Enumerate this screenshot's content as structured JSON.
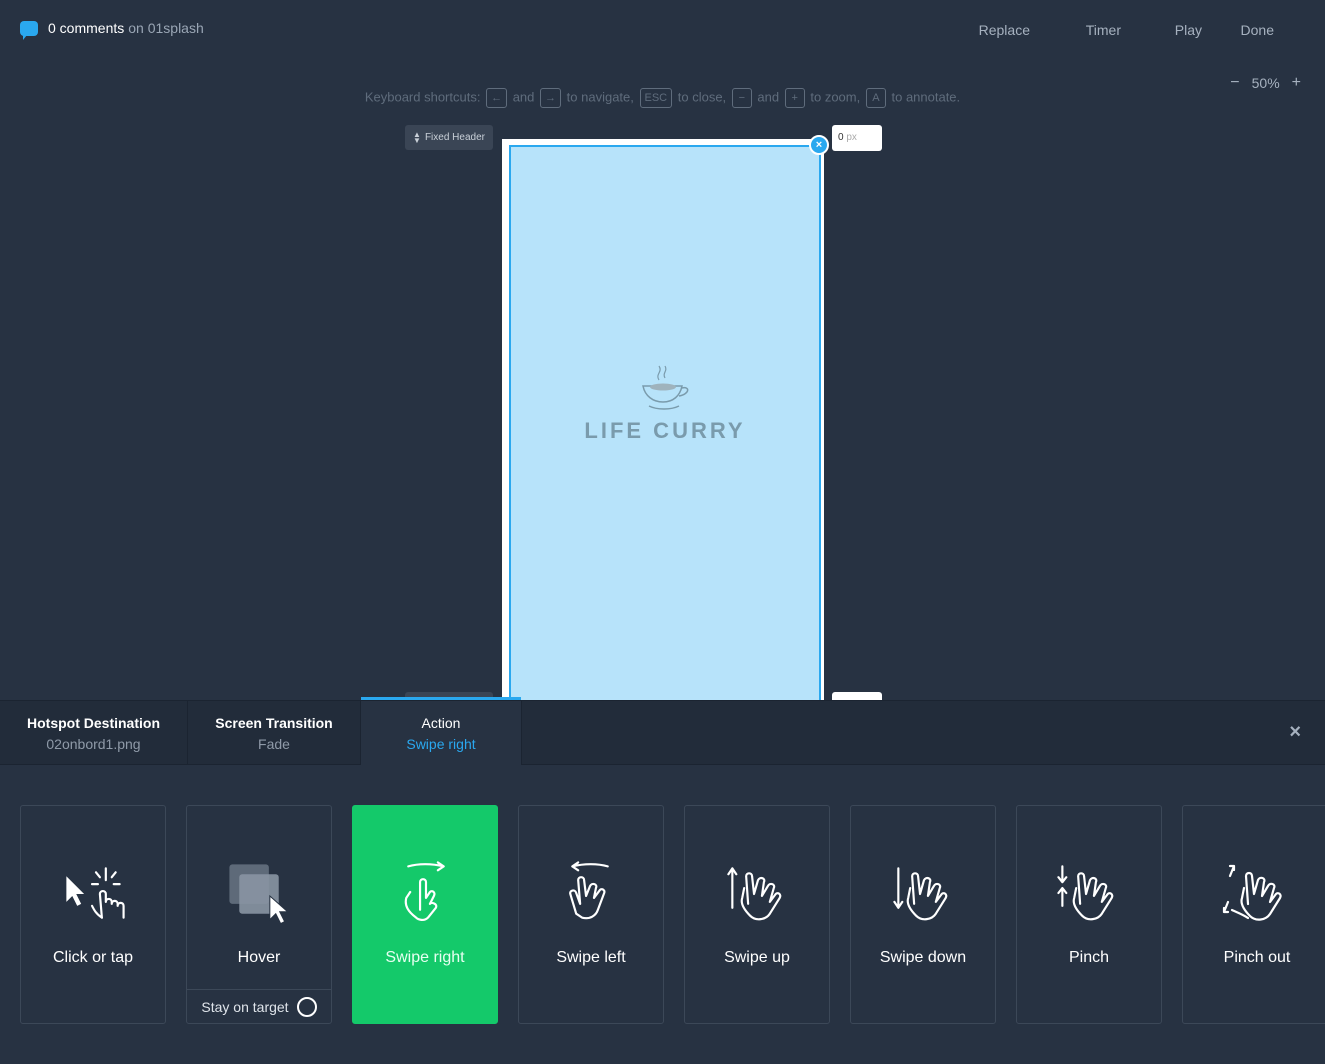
{
  "topbar": {
    "comments_count": "0 comments",
    "comments_on": "on 01splash",
    "nav": {
      "replace": "Replace",
      "timer": "Timer",
      "play": "Play",
      "done": "Done"
    }
  },
  "zoom": {
    "minus": "−",
    "value": "50%",
    "plus": "+"
  },
  "shortcuts": {
    "intro": "Keyboard shortcuts:",
    "key_left": "←",
    "and1": "and",
    "key_right": "→",
    "navigate": "to navigate,",
    "key_esc": "ESC",
    "close": "to close,",
    "key_minus": "−",
    "and2": "and",
    "key_plus": "+",
    "zoom": "to zoom,",
    "key_a": "A",
    "annotate": "to annotate."
  },
  "canvas": {
    "fixed_header_label": "Fixed Header",
    "px_value": "0",
    "px_unit": "px",
    "logo_text": "LIFE CURRY",
    "hotspot_close": "×"
  },
  "panel": {
    "tabs": [
      {
        "label": "Hotspot Destination",
        "value": "02onbord1.png"
      },
      {
        "label": "Screen Transition",
        "value": "Fade"
      },
      {
        "label": "Action",
        "value": "Swipe right"
      }
    ],
    "close": "×",
    "actions": [
      {
        "label": "Click or tap",
        "icon": "click-tap-icon"
      },
      {
        "label": "Hover",
        "icon": "hover-icon",
        "stay_label": "Stay on target"
      },
      {
        "label": "Swipe right",
        "icon": "swipe-right-icon",
        "active": true
      },
      {
        "label": "Swipe left",
        "icon": "swipe-left-icon"
      },
      {
        "label": "Swipe up",
        "icon": "swipe-up-icon"
      },
      {
        "label": "Swipe down",
        "icon": "swipe-down-icon"
      },
      {
        "label": "Pinch",
        "icon": "pinch-icon"
      },
      {
        "label": "Pinch out",
        "icon": "pinch-out-icon"
      }
    ]
  },
  "colors": {
    "background": "#273242",
    "accent": "#2aa8ef",
    "active": "#14c96a",
    "screen": "#b7e3fa"
  }
}
